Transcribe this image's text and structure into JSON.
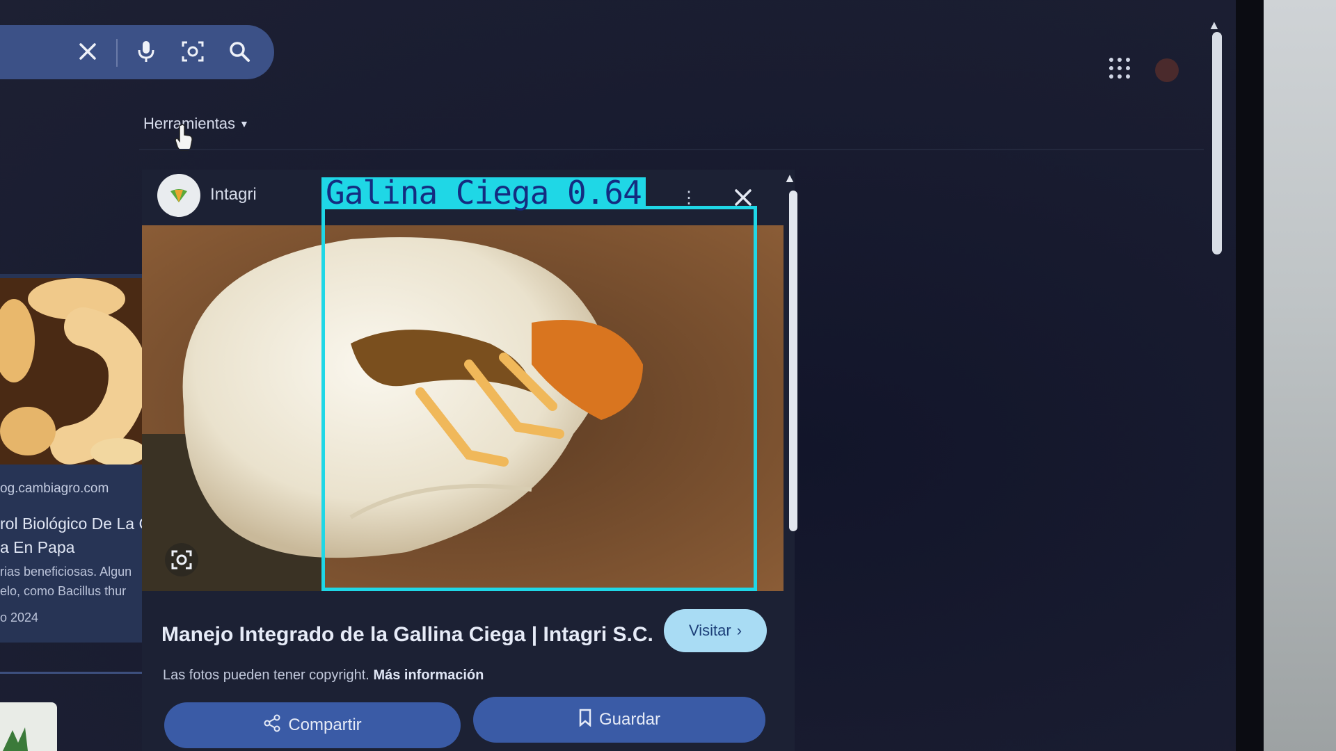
{
  "search_bar": {
    "clear_icon": "close-icon",
    "voice_icon": "microphone-icon",
    "lens_icon": "camera-lens-icon",
    "search_icon": "search-icon"
  },
  "header": {
    "tools_label": "Herramientas",
    "apps_icon": "grid-apps-icon"
  },
  "left_result": {
    "domain": "og.cambiagro.com",
    "title_line1": "rol Biológico De La G",
    "title_line2": "a En Papa",
    "snippet_line1": "rias beneficiosas. Algun",
    "snippet_line2": "elo, como Bacillus thur",
    "date": "o 2024"
  },
  "preview": {
    "source_name": "Intagri",
    "title": "Manejo Integrado de la Gallina Ciega | Intagri S.C.",
    "visit_label": "Visitar",
    "copyright_text": "Las fotos pueden tener copyright.",
    "more_info_label": "Más información",
    "share_label": "Compartir",
    "save_label": "Guardar"
  },
  "detection": {
    "label": "Galina Ciega 0.64",
    "color": "#1fd7e6"
  },
  "colors": {
    "accent_button": "#3a5ba6",
    "visit_button": "#a9dcf4",
    "search_bar": "#3c5187"
  }
}
